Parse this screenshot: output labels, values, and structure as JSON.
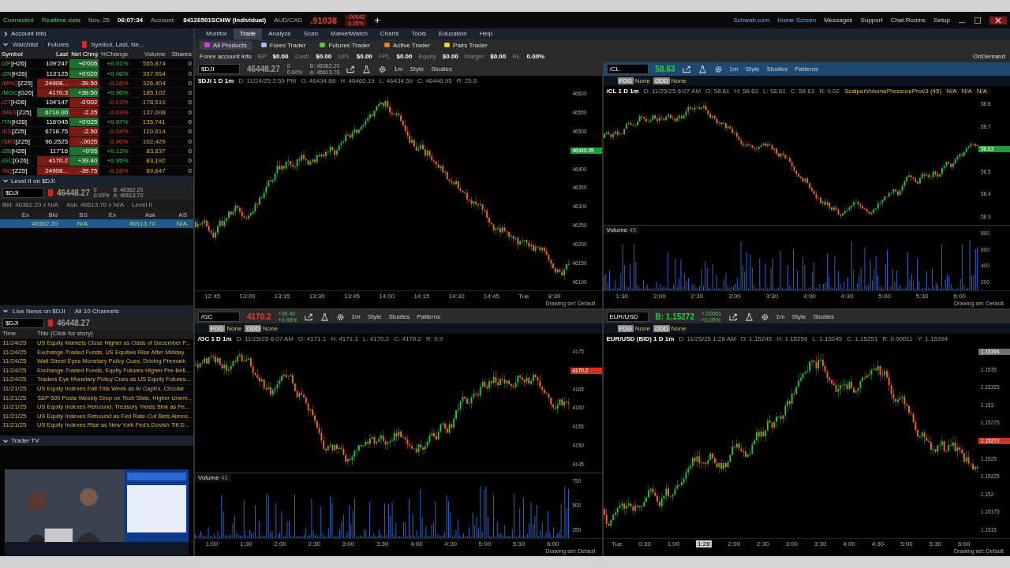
{
  "status_bar": {
    "connection": "Connected",
    "feed": "Realtime data",
    "date": "Nov, 25",
    "time": "06:07:34",
    "account_label": "Account:",
    "account": "84126501SCHW (Individual)",
    "pair": "AUD/CAD",
    "pair_price": ".91038",
    "pair_change": [
      "-.00042",
      "-0.05%"
    ],
    "add": "+"
  },
  "top_links": [
    "Schwab.com",
    "Home Screen",
    "Messages",
    "Support",
    "Chat Rooms",
    "Setup"
  ],
  "on_demand": "OnDemand",
  "account_info": {
    "title": "Account Info"
  },
  "watchlist": {
    "title": "Watchlist",
    "list": "Futures",
    "columns_set": "Symbol, Last, Ne...",
    "columns": [
      "Symbol",
      "Last",
      "Net Chng",
      "%Change",
      "Volume",
      "Shares"
    ],
    "rows": [
      {
        "root": "/ZF",
        "contract": "[H26]",
        "last": "109'247",
        "last_highlight": false,
        "change": "+0'005",
        "rising": true,
        "pct": "+0.01%",
        "volume": "555,874",
        "shares": "0"
      },
      {
        "root": "/ZN",
        "contract": "[H26]",
        "last": "113'125",
        "last_highlight": false,
        "change": "+0'020",
        "rising": true,
        "pct": "+0.06%",
        "volume": "337,954",
        "shares": "0"
      },
      {
        "root": "/MNQ",
        "contract": "[Z25]",
        "last": "24908...",
        "last_highlight": true,
        "last_rising": false,
        "change": "-39.50",
        "rising": false,
        "pct": "-0.16%",
        "volume": "326,404",
        "shares": "0"
      },
      {
        "root": "/MGC",
        "contract": "[G26]",
        "last": "4170.3",
        "last_highlight": true,
        "last_rising": false,
        "change": "+39.50",
        "rising": true,
        "pct": "+0.96%",
        "volume": "185,102",
        "shares": "0"
      },
      {
        "root": "/ZT",
        "contract": "[H26]",
        "last": "104'147",
        "last_highlight": false,
        "change": "-0'002",
        "rising": false,
        "pct": "-0.01%",
        "volume": "178,510",
        "shares": "0"
      },
      {
        "root": "/MES",
        "contract": "[Z25]",
        "last": "6719.00",
        "last_highlight": true,
        "last_rising": true,
        "change": "-2.25",
        "rising": false,
        "pct": "-0.03%",
        "volume": "137,008",
        "shares": "0"
      },
      {
        "root": "/TN",
        "contract": "[H26]",
        "last": "116'045",
        "last_highlight": false,
        "change": "+0'025",
        "rising": true,
        "pct": "+0.07%",
        "volume": "135,741",
        "shares": "0"
      },
      {
        "root": "/ES",
        "contract": "[Z25]",
        "last": "6718.75",
        "last_highlight": false,
        "change": "-2.50",
        "rising": false,
        "pct": "-0.04%",
        "volume": "110,614",
        "shares": "0"
      },
      {
        "root": "/SR3",
        "contract": "[Z25]",
        "last": "96.2525",
        "last_highlight": false,
        "change": "-.0025",
        "rising": false,
        "pct": "0.00%",
        "volume": "102,429",
        "shares": "0"
      },
      {
        "root": "/ZB",
        "contract": "[H26]",
        "last": "117'16",
        "last_highlight": false,
        "change": "+0'05",
        "rising": true,
        "pct": "+0.13%",
        "volume": "83,837",
        "shares": "0"
      },
      {
        "root": "/GC",
        "contract": "[G26]",
        "last": "4170.2",
        "last_highlight": true,
        "last_rising": false,
        "change": "+39.40",
        "rising": true,
        "pct": "+0.95%",
        "volume": "83,192",
        "shares": "0"
      },
      {
        "root": "/NQ",
        "contract": "[Z25]",
        "last": "24908...",
        "last_highlight": true,
        "last_rising": false,
        "change": "-39.75",
        "rising": false,
        "pct": "-0.16%",
        "volume": "69,647",
        "shares": "0"
      }
    ]
  },
  "level2": {
    "title": "Level II on $DJI",
    "symbol": "$DJI",
    "price": "46448.27",
    "changes": [
      "0",
      "0.00%"
    ],
    "quotes": [
      "B: 46362.20",
      "A: 46613.70"
    ],
    "bid": "Bid: 46362.20 x N/A",
    "ask": "Ask: 46613.70 x N/A",
    "mode": "Level II",
    "columns": [
      "Ex",
      "Bid",
      "BS",
      "Ex",
      "Ask",
      "AS"
    ],
    "rows": [
      {
        "cells": [
          "",
          "46362.20",
          "N/A",
          "",
          "46613.70",
          "N/A"
        ],
        "selected": true
      }
    ]
  },
  "news": {
    "title": "Live News on $DJI",
    "channels": "All 10 Channels",
    "symbol": "$DJI",
    "price": "46448.27",
    "columns": [
      "Time",
      "Title (Click for story)"
    ],
    "items": [
      {
        "time": "11/24/25",
        "title": "US Equity Markets Close Higher as Odds of December F..."
      },
      {
        "time": "11/24/25",
        "title": "Exchange-Traded Funds, US Equities Rise After Midday"
      },
      {
        "time": "11/24/25",
        "title": "Wall Street Eyes Monetary Policy Cues, Driving Premark"
      },
      {
        "time": "11/24/25",
        "title": "Exchange-Traded Funds, Equity Futures Higher Pre-Bell..."
      },
      {
        "time": "11/24/25",
        "title": "Traders Eye Monetary Policy Cues as US Equity Futures..."
      },
      {
        "time": "11/21/25",
        "title": "US Equity Indexes Fall This Week as AI CapEx, Circular"
      },
      {
        "time": "11/21/25",
        "title": "S&P 500 Posts Weekly Drop on Tech Slide, Higher Unem..."
      },
      {
        "time": "11/21/25",
        "title": "US Equity Indexes Rebound, Treasury Yields Sink as Fe..."
      },
      {
        "time": "11/21/25",
        "title": "US Equity Indexes Rebound as Fed Rate-Cut Bets Almos..."
      },
      {
        "time": "11/21/25",
        "title": "US Equity Indexes Rise as New York Fed's Dovish Tilt D..."
      }
    ]
  },
  "trader_tv": {
    "title": "Trader TV"
  },
  "menu": [
    {
      "label": "Monitor",
      "selected": false
    },
    {
      "label": "Trade",
      "selected": true
    },
    {
      "label": "Analyze",
      "selected": false
    },
    {
      "label": "Scan",
      "selected": false
    },
    {
      "label": "MarketWatch",
      "selected": false
    },
    {
      "label": "Charts",
      "selected": false
    },
    {
      "label": "Tools",
      "selected": false
    },
    {
      "label": "Education",
      "selected": false
    },
    {
      "label": "Help",
      "selected": false
    }
  ],
  "sub_tabs": [
    {
      "label": "All Products",
      "selected": true,
      "color": "#d040d0"
    },
    {
      "label": "Forex Trader",
      "selected": false,
      "color": "#a0c0ff"
    },
    {
      "label": "Futures Trader",
      "selected": false,
      "color": "#60c040"
    },
    {
      "label": "Active Trader",
      "selected": false,
      "color": "#f08020"
    },
    {
      "label": "Pairs Trader",
      "selected": false,
      "color": "#f0d020"
    }
  ],
  "forex_info": {
    "title": "Forex account info",
    "fields": [
      {
        "label": "BP",
        "value": "$0.00"
      },
      {
        "label": "Cash",
        "value": "$0.00"
      },
      {
        "label": "UPL",
        "value": "$0.00"
      },
      {
        "label": "FPL",
        "value": "$0.00"
      },
      {
        "label": "Equity",
        "value": "$0.00"
      },
      {
        "label": "Margin",
        "value": "$0.00"
      },
      {
        "label": "RL",
        "value": "0.00%"
      }
    ]
  },
  "charts": [
    {
      "symbol": "$DJI",
      "selected": false,
      "price": "46448.27",
      "unchanged": true,
      "changes": [
        "0",
        "0.00%"
      ],
      "quotes": [
        "B: 46362.20",
        "A: 46613.70"
      ],
      "tools": [
        "1m",
        "Style",
        "Studies"
      ],
      "title": "$DJI 1 D 1m",
      "fields": [
        "D: 11/24/25 2:59 PM",
        "O: 46434.88",
        "H: 46460.19",
        "L: 46434.59",
        "C: 46446.95",
        "R: 25.6"
      ],
      "y_labels": [
        {
          "label": "46600"
        },
        {
          "label": "46550"
        },
        {
          "label": "46500"
        },
        {
          "label": "46446.95",
          "color": "#1e9e3a"
        },
        {
          "label": "46400"
        },
        {
          "label": "46350"
        },
        {
          "label": "46300"
        },
        {
          "label": "46250"
        },
        {
          "label": "46200"
        },
        {
          "label": "46150"
        },
        {
          "label": "46100"
        }
      ],
      "x_labels": [
        {
          "label": "12:45",
          "cursor": false
        },
        {
          "label": "13:00",
          "cursor": false
        },
        {
          "label": "13:15",
          "cursor": false
        },
        {
          "label": "13:30",
          "cursor": false
        },
        {
          "label": "13:45",
          "cursor": false
        },
        {
          "label": "14:00",
          "cursor": false
        },
        {
          "label": "14:15",
          "cursor": false
        },
        {
          "label": "14:30",
          "cursor": false
        },
        {
          "label": "14:45",
          "cursor": false
        },
        {
          "label": "Tue",
          "cursor": false
        },
        {
          "label": "8:39",
          "cursor": false
        }
      ],
      "footer": "Drawing set: Default"
    },
    {
      "symbol": "/CL",
      "selected": true,
      "price": "58.63",
      "unchanged": false,
      "rising": true,
      "tools": [
        "1m",
        "Style",
        "Studies",
        "Patterns"
      ],
      "studies": [
        {
          "badge": "FOG",
          "label": "None"
        },
        {
          "badge": "ODD",
          "label": "None"
        }
      ],
      "title": "/CL 1 D 1m",
      "fields": [
        "D: 11/25/25 6:07 AM",
        "O: 58.61",
        "H: 58.63",
        "L: 58.61",
        "C: 58.63",
        "R: 0.02"
      ],
      "indicators": [
        "ScalperVolumePressureProv3 (45)",
        "N/A",
        "N/A",
        "N/A"
      ],
      "y_labels": [
        {
          "label": "58.8"
        },
        {
          "label": "58.7"
        },
        {
          "label": "58.63",
          "color": "#1e9e3a"
        },
        {
          "label": "58.5"
        },
        {
          "label": "58.4"
        },
        {
          "label": "58.3"
        }
      ],
      "volume": {
        "label": "Volume",
        "value": "45",
        "y_labels": [
          "800",
          "600",
          "400",
          "200"
        ]
      },
      "x_labels": [
        {
          "label": "1:30",
          "cursor": false
        },
        {
          "label": "2:00",
          "cursor": false
        },
        {
          "label": "2:30",
          "cursor": false
        },
        {
          "label": "3:00",
          "cursor": false
        },
        {
          "label": "3:30",
          "cursor": false
        },
        {
          "label": "4:00",
          "cursor": false
        },
        {
          "label": "4:30",
          "cursor": false
        },
        {
          "label": "5:00",
          "cursor": false
        },
        {
          "label": "5:30",
          "cursor": false
        },
        {
          "label": "6:00",
          "cursor": false
        }
      ],
      "footer": "Drawing set: Default"
    },
    {
      "symbol": "/GC",
      "selected": false,
      "price": "4170.2",
      "unchanged": false,
      "rising": false,
      "changes": [
        "+39.40",
        "+0.95%"
      ],
      "tools": [
        "1m",
        "Style",
        "Studies",
        "Patterns"
      ],
      "studies": [
        {
          "badge": "FOG",
          "label": "None"
        },
        {
          "badge": "ODD",
          "label": "None"
        }
      ],
      "title": "/GC 1 D 1m",
      "fields": [
        "D: 11/25/25 6:07 AM",
        "O: 4171.1",
        "H: 4171.1",
        "L: 4170.2",
        "C: 4170.2",
        "R: 0.9"
      ],
      "y_labels": [
        {
          "label": "4175"
        },
        {
          "label": "4170.2",
          "color": "#d03020"
        },
        {
          "label": "4165"
        },
        {
          "label": "4160"
        },
        {
          "label": "4155"
        },
        {
          "label": "4150"
        },
        {
          "label": "4145"
        }
      ],
      "volume": {
        "label": "Volume",
        "value": "41",
        "y_labels": [
          "750",
          "500",
          "250"
        ]
      },
      "x_labels": [
        {
          "label": "1:00",
          "cursor": false
        },
        {
          "label": "1:30",
          "cursor": false
        },
        {
          "label": "2:00",
          "cursor": false
        },
        {
          "label": "2:30",
          "cursor": false
        },
        {
          "label": "3:00",
          "cursor": false
        },
        {
          "label": "3:30",
          "cursor": false
        },
        {
          "label": "4:00",
          "cursor": false
        },
        {
          "label": "4:30",
          "cursor": false
        },
        {
          "label": "5:00",
          "cursor": false
        },
        {
          "label": "5:30",
          "cursor": false
        },
        {
          "label": "6:00",
          "cursor": false
        }
      ],
      "footer": "Drawing set: Default"
    },
    {
      "symbol": "EUR/USD",
      "selected": false,
      "price": "B: 1.15272",
      "unchanged": false,
      "rising": true,
      "changes": [
        "+.00061",
        "+0.05%"
      ],
      "tools": [
        "1m",
        "Style",
        "Studies"
      ],
      "studies": [
        {
          "badge": "FOG",
          "label": "None"
        },
        {
          "badge": "ODD",
          "label": "None"
        }
      ],
      "title": "EUR/USD (BID) 1 D 1m",
      "fields": [
        "D: 11/25/25 1:28 AM",
        "O: 1.15245",
        "H: 1.15256",
        "L: 1.15245",
        "C: 1.15251",
        "R: 0.00011",
        "Y: 1.15394"
      ],
      "y_labels": [
        {
          "label": "1.15394",
          "color": "#707070"
        },
        {
          "label": "1.1535"
        },
        {
          "label": "1.15325"
        },
        {
          "label": "1.153"
        },
        {
          "label": "1.15275"
        },
        {
          "label": "1.15272",
          "color": "#d03020"
        },
        {
          "label": "1.1525"
        },
        {
          "label": "1.15225"
        },
        {
          "label": "1.152"
        },
        {
          "label": "1.15175"
        },
        {
          "label": "1.1515"
        }
      ],
      "x_labels": [
        {
          "label": "Tue",
          "cursor": false
        },
        {
          "label": "0:30",
          "cursor": false
        },
        {
          "label": "1:00",
          "cursor": false
        },
        {
          "label": "1:28",
          "cursor": true
        },
        {
          "label": "2:00",
          "cursor": false
        },
        {
          "label": "2:30",
          "cursor": false
        },
        {
          "label": "3:00",
          "cursor": false
        },
        {
          "label": "3:30",
          "cursor": false
        },
        {
          "label": "4:00",
          "cursor": false
        },
        {
          "label": "4:30",
          "cursor": false
        },
        {
          "label": "5:00",
          "cursor": false
        },
        {
          "label": "5:30",
          "cursor": false
        },
        {
          "label": "6:00",
          "cursor": false
        }
      ],
      "footer": "Drawing set: Default"
    }
  ]
}
